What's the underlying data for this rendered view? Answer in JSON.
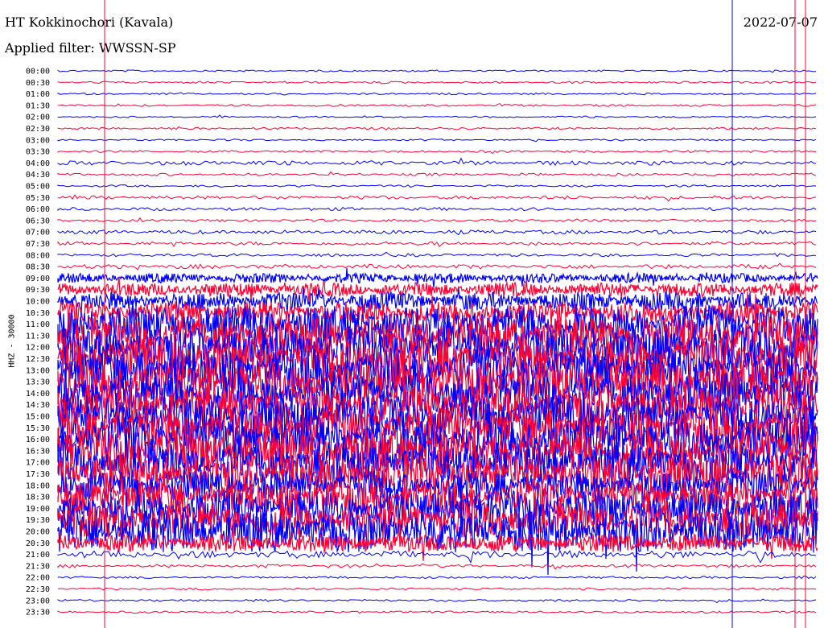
{
  "header": {
    "station": "HT Kokkinochori (Kavala)",
    "filter": "Applied filter: WWSSN-SP",
    "date": "2022-07-07"
  },
  "chart_data": {
    "type": "line",
    "title": "HT Kokkinochori (Kavala)",
    "subtitle": "Applied filter: WWSSN-SP",
    "ylabel": "HHZ - 30000",
    "date": "2022-07-07",
    "rows": [
      "00:00",
      "00:30",
      "01:00",
      "01:30",
      "02:00",
      "02:30",
      "03:00",
      "03:30",
      "04:00",
      "04:30",
      "05:00",
      "05:30",
      "06:00",
      "06:30",
      "07:00",
      "07:30",
      "08:00",
      "08:30",
      "09:00",
      "09:30",
      "10:00",
      "10:30",
      "11:00",
      "11:30",
      "12:00",
      "12:30",
      "13:00",
      "13:30",
      "14:00",
      "14:30",
      "15:00",
      "15:30",
      "16:00",
      "16:30",
      "17:00",
      "17:30",
      "18:00",
      "18:30",
      "19:00",
      "19:30",
      "20:00",
      "20:30",
      "21:00",
      "21:30",
      "22:00",
      "22:30",
      "23:00",
      "23:30"
    ],
    "row_colors": [
      "#0000ff",
      "#ff0033"
    ],
    "activity_level": [
      0.02,
      0.03,
      0.02,
      0.03,
      0.02,
      0.03,
      0.02,
      0.03,
      0.08,
      0.04,
      0.03,
      0.06,
      0.05,
      0.04,
      0.07,
      0.06,
      0.05,
      0.08,
      0.2,
      0.3,
      0.4,
      0.5,
      0.85,
      0.9,
      0.95,
      1.0,
      1.0,
      1.0,
      0.95,
      0.9,
      0.95,
      0.95,
      1.0,
      0.95,
      0.9,
      0.9,
      0.7,
      0.75,
      0.8,
      0.85,
      0.95,
      0.4,
      0.15,
      0.05,
      0.03,
      0.03,
      0.03,
      0.03
    ],
    "colors": {
      "blue": "#0000ff",
      "red": "#ff0033"
    }
  }
}
